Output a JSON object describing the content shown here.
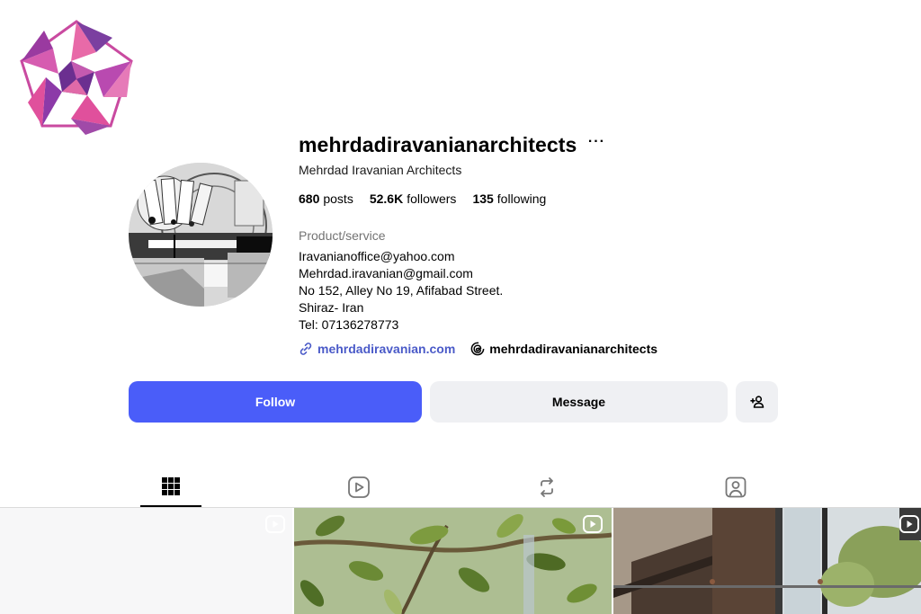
{
  "profile": {
    "username": "mehrdadiravanianarchitects",
    "more_label": "···",
    "full_name": "Mehrdad Iravanian Architects",
    "stats": {
      "posts_count": "680",
      "posts_label": "posts",
      "followers_count": "52.6K",
      "followers_label": "followers",
      "following_count": "135",
      "following_label": "following"
    },
    "category": "Product/service",
    "bio_lines": [
      "Iravanianoffice@yahoo.com",
      "Mehrdad.iravanian@gmail.com",
      "No 152, Alley No 19, Afifabad Street.",
      "Shiraz- Iran",
      "Tel: 07136278773"
    ],
    "website": "mehrdadiravanian.com",
    "threads_handle": "mehrdadiravanianarchitects"
  },
  "actions": {
    "follow_label": "Follow",
    "message_label": "Message",
    "suggest_icon": "add-person-icon"
  },
  "tabs": [
    {
      "icon": "grid-icon",
      "active": true
    },
    {
      "icon": "reels-icon",
      "active": false
    },
    {
      "icon": "reposts-icon",
      "active": false
    },
    {
      "icon": "tagged-icon",
      "active": false
    }
  ],
  "colors": {
    "follow_button": "#4a5df9",
    "secondary_button": "#eff0f3",
    "link": "#4a5ac8",
    "muted_text": "#737373",
    "logo_primary": "#7b3fa0",
    "logo_accent": "#e0509c"
  }
}
